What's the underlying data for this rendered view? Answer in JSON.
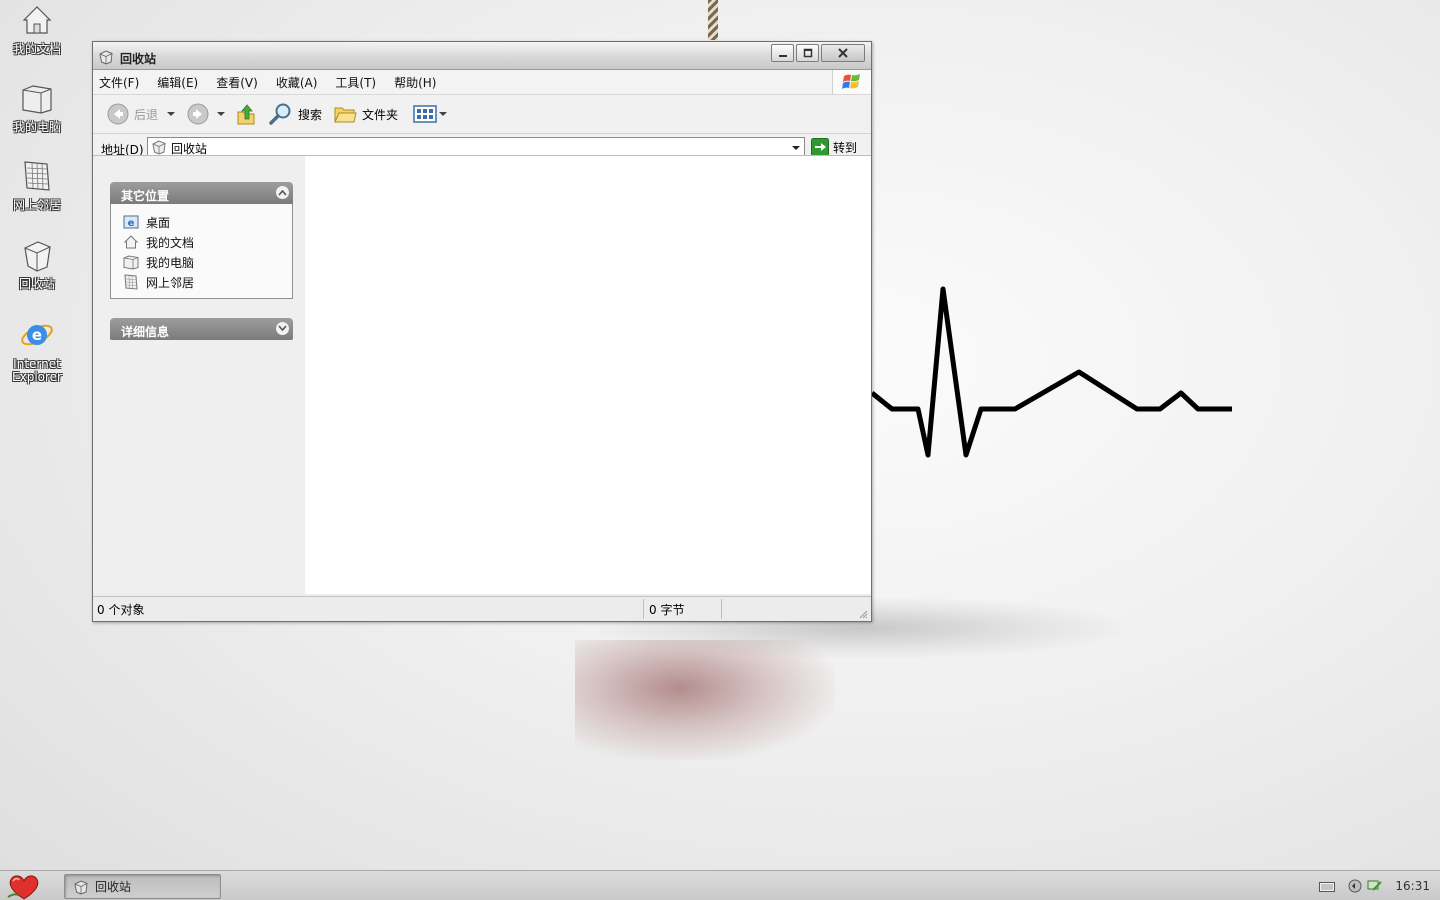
{
  "desktop": {
    "icons": [
      {
        "label": "我的文档",
        "icon": "my-documents-icon"
      },
      {
        "label": "我的电脑",
        "icon": "my-computer-icon"
      },
      {
        "label": "网上邻居",
        "icon": "network-places-icon"
      },
      {
        "label": "回收站",
        "icon": "recycle-bin-icon"
      },
      {
        "label": "Internet Explorer",
        "icon": "internet-explorer-icon"
      }
    ]
  },
  "window": {
    "title": "回收站",
    "menu": [
      "文件(F)",
      "编辑(E)",
      "查看(V)",
      "收藏(A)",
      "工具(T)",
      "帮助(H)"
    ],
    "toolbar": {
      "back_label": "后退",
      "search_label": "搜索",
      "folders_label": "文件夹"
    },
    "address": {
      "label": "地址(D)",
      "value": "回收站",
      "go_label": "转到"
    },
    "taskpane": {
      "other_places": {
        "title": "其它位置",
        "items": [
          "桌面",
          "我的文档",
          "我的电脑",
          "网上邻居"
        ]
      },
      "details": {
        "title": "详细信息"
      }
    },
    "status": {
      "objects": "0 个对象",
      "size": "0 字节"
    }
  },
  "taskbar": {
    "task_label": "回收站",
    "clock": "16:31"
  },
  "colors": {
    "panel_head": "#8a8a8a",
    "heartbeat": "#000000",
    "go_arrow": "#2f9a2f"
  }
}
